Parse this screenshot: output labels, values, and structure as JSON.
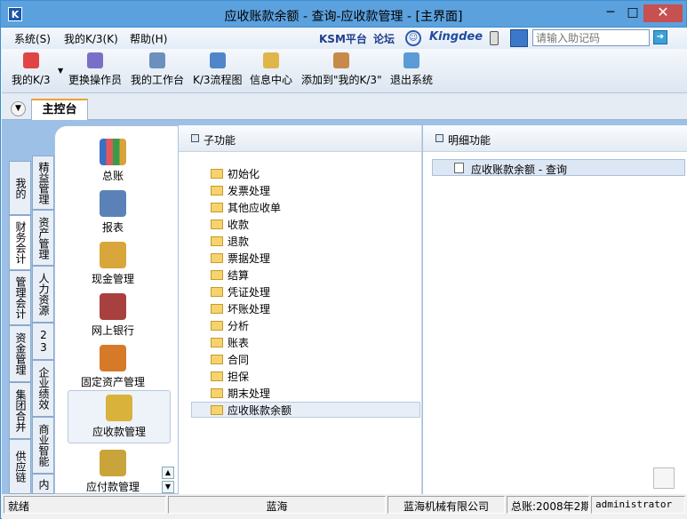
{
  "window": {
    "title": "应收账款余额 - 查询-应收款管理 - [主界面]",
    "icon_text": "K",
    "minimize_glyph": "─",
    "restore_glyph": "□",
    "close_glyph": "✕"
  },
  "menubar": {
    "items": [
      "系统(S)",
      "我的K/3(K)",
      "帮助(H)"
    ],
    "ksm": "KSM平台",
    "forum": "论坛",
    "brand": "Kingdee",
    "help_placeholder": "请输入助记码"
  },
  "toolbar": {
    "items": [
      "我的K/3",
      "更换操作员",
      "我的工作台",
      "K/3流程图",
      "信息中心",
      "添加到\"我的K/3\"",
      "退出系统"
    ]
  },
  "tabs": {
    "main": "主控台"
  },
  "vertical_tabs": {
    "col1": [
      "我的K/3",
      "财务会计",
      "管理会计",
      "资金管理",
      "集团合并",
      "供应链"
    ],
    "col2": [
      "精益管理",
      "资产管理",
      "人力资源",
      "23",
      "企业绩效",
      "商业智能",
      "内"
    ]
  },
  "modules": [
    "总账",
    "报表",
    "现金管理",
    "网上银行",
    "固定资产管理",
    "应收款管理",
    "应付款管理"
  ],
  "subfunctions": {
    "header": "子功能",
    "items": [
      "初始化",
      "发票处理",
      "其他应收单",
      "收款",
      "退款",
      "票据处理",
      "结算",
      "凭证处理",
      "坏账处理",
      "分析",
      "账表",
      "合同",
      "担保",
      "期末处理",
      "应收账款余额"
    ]
  },
  "details": {
    "header": "明细功能",
    "items": [
      "应收账款余额 - 查询"
    ]
  },
  "statusbar": {
    "status": "就绪",
    "user_group": "蓝海",
    "company": "蓝海机械有限公司",
    "period": "总账:2008年2期",
    "user": "administrator"
  },
  "colors": {
    "titlebar": "#5ba1de",
    "workspace": "#9cc0e6",
    "close": "#c75050"
  }
}
